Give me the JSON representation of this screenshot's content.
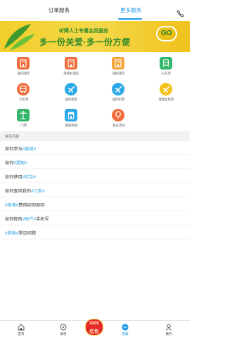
{
  "header": {
    "tabs": [
      {
        "label": "订单服务",
        "active": false
      },
      {
        "label": "更多服务",
        "active": true
      }
    ],
    "accent": "#1d9be6"
  },
  "banner": {
    "line1": "听障人士专属会员服务",
    "line2": "多一份关爱·多一份方便",
    "go": "GO"
  },
  "services": [
    {
      "label": "国内酒店",
      "icon": "hotel-icon",
      "color": "#f26b3a"
    },
    {
      "label": "港澳台酒店",
      "icon": "hotel-icon",
      "color": "#f26b3a"
    },
    {
      "label": "国际酒店",
      "icon": "hotel-icon",
      "color": "#f5a53a"
    },
    {
      "label": "火车票",
      "icon": "train-icon",
      "color": "#33b66a"
    },
    {
      "label": "汽车票",
      "icon": "bus-icon",
      "color": "#f26b3a"
    },
    {
      "label": "国内机票",
      "icon": "plane-icon",
      "color": "#2aa8e8"
    },
    {
      "label": "国际机票",
      "icon": "plane-icon",
      "color": "#2aa8e8"
    },
    {
      "label": "港澳台机票",
      "icon": "plane-icon",
      "color": "#f5c21a"
    },
    {
      "label": "门票",
      "icon": "palm-tree-icon",
      "color": "#33b66a"
    },
    {
      "label": "度假商城",
      "icon": "shop-icon",
      "color": "#2aa8e8"
    },
    {
      "label": "会员活动",
      "icon": "balloon-icon",
      "color": "#f26b3a"
    }
  ],
  "faq": {
    "title": "常见问题",
    "items": [
      {
        "pre": "如何参与",
        "hl": "#返现#",
        "post": ""
      },
      {
        "pre": "如何",
        "hl": "#提现#",
        "post": ""
      },
      {
        "pre": "如何使用",
        "hl": "#红包#",
        "post": ""
      },
      {
        "pre": "如何查询我的",
        "hl": "#订单#",
        "post": ""
      },
      {
        "pre": "",
        "hl": "#担保#",
        "post": "费用如何退回"
      },
      {
        "pre": "如何修改",
        "hl": "#账户#",
        "post": "手机号"
      },
      {
        "pre": "",
        "hl": "#其他#",
        "post": "常见问题"
      }
    ]
  },
  "bottom_nav": [
    {
      "label": "首页",
      "icon": "home-icon",
      "active": false
    },
    {
      "label": "发现",
      "icon": "compass-icon",
      "active": false
    },
    {
      "label": "",
      "icon": "red-packet-icon",
      "active": false
    },
    {
      "label": "客服",
      "icon": "chat-icon",
      "active": true
    },
    {
      "label": "我的",
      "icon": "user-icon",
      "active": false
    }
  ],
  "red_packet": {
    "amount": "¥200",
    "word": "红包"
  }
}
